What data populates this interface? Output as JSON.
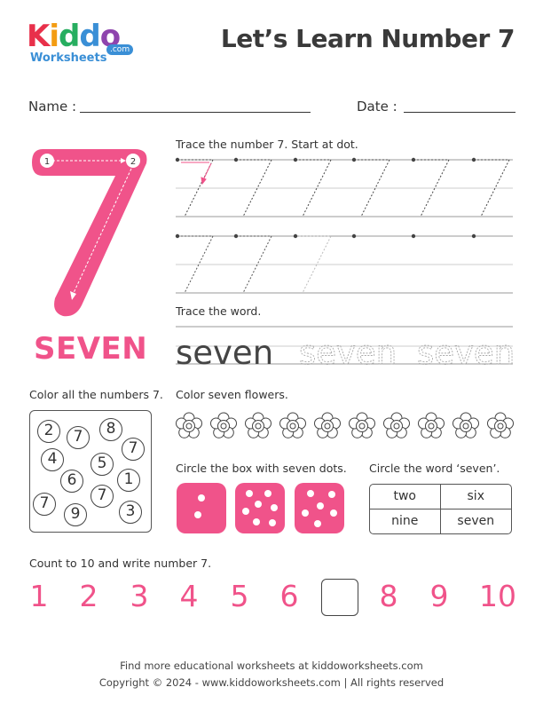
{
  "brand": {
    "kiddo_letters": [
      "K",
      "i",
      "d",
      "d",
      "o"
    ],
    "kiddo_colors": [
      "#e8304a",
      "#f39c12",
      "#27ae60",
      "#3a8fd6",
      "#8e44ad"
    ],
    "sub": "Worksheets",
    "com": ".com"
  },
  "title": "Let’s Learn Number 7",
  "name_label": "Name :",
  "date_label": "Date :",
  "big_number": {
    "digit": "7",
    "start_dot_1": "1",
    "start_dot_2": "2",
    "color": "#f0538a"
  },
  "number_word": "SEVEN",
  "instructions": {
    "trace_number": "Trace the number 7. Start at dot.",
    "trace_word": "Trace the word.",
    "color_numbers": "Color all the numbers 7.",
    "color_flowers": "Color seven flowers.",
    "circle_box": "Circle the box with seven dots.",
    "circle_word": "Circle the word ‘seven’.",
    "count": "Count to 10 and write number 7."
  },
  "trace_words": [
    "seven",
    "seven",
    "seven"
  ],
  "number_grid": [
    "2",
    "7",
    "8",
    "7",
    "4",
    "5",
    "6",
    "1",
    "7",
    "7",
    "9",
    "3"
  ],
  "flower_count": 10,
  "dice": [
    {
      "dots": 2
    },
    {
      "dots": 7
    },
    {
      "dots": 6
    }
  ],
  "word_table": [
    "two",
    "six",
    "nine",
    "seven"
  ],
  "count_sequence": [
    "1",
    "2",
    "3",
    "4",
    "5",
    "6",
    "",
    "8",
    "9",
    "10"
  ],
  "footer": {
    "line1": "Find more educational worksheets at kiddoworksheets.com",
    "line2": "Copyright © 2024 - www.kiddoworksheets.com  |  All rights reserved"
  }
}
